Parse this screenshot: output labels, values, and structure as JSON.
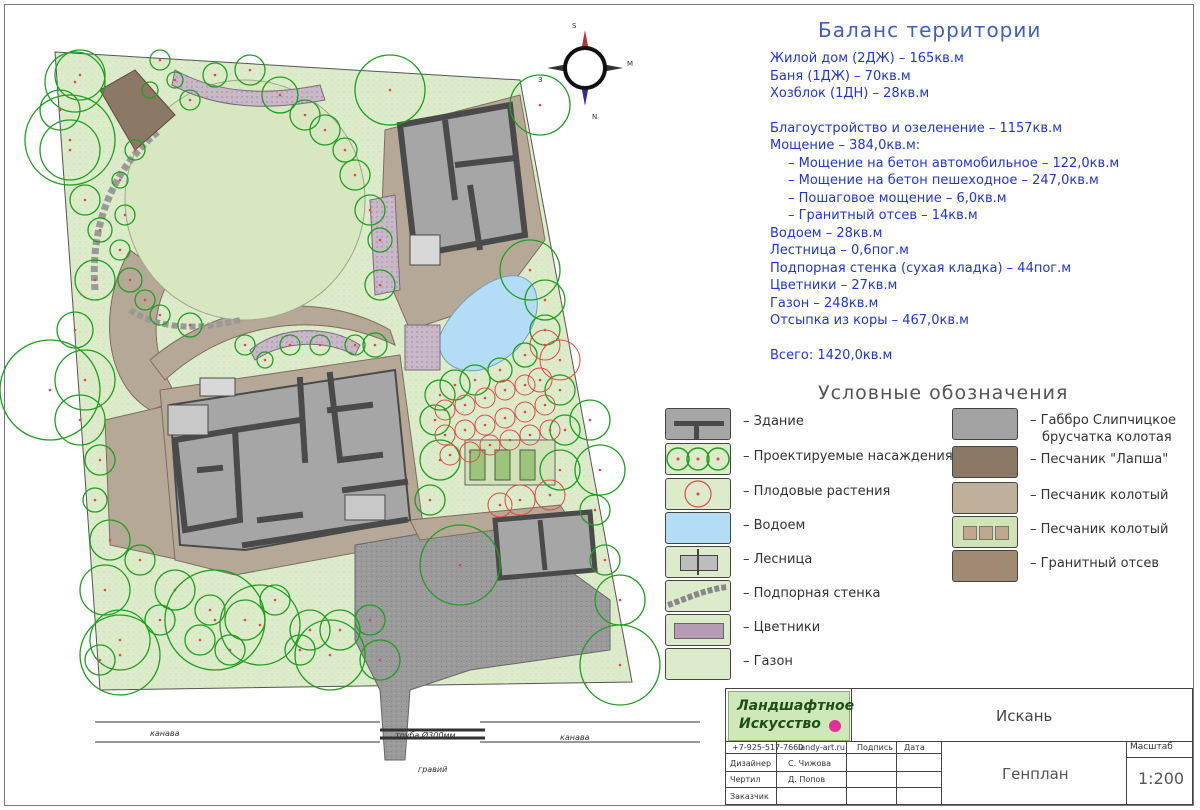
{
  "balance": {
    "title": "Баланс территории",
    "lines": [
      "Жилой дом (2ДЖ) – 165кв.м",
      "Баня (1ДЖ) – 70кв.м",
      "Хозблок (1ДН) – 28кв.м"
    ],
    "lines2": [
      "Благоустройство и озеленение – 1157кв.м",
      "Мощение – 384,0кв.м:"
    ],
    "sub": [
      "– Мощение на бетон автомобильное – 122,0кв.м",
      "– Мощение на бетон пешеходное – 247,0кв.м",
      "– Пошаговое мощение – 6,0кв.м",
      "– Гранитный отсев – 14кв.м"
    ],
    "lines3": [
      "Водоем – 28кв.м",
      "Лестница – 0,6пог.м",
      "Подпорная стенка (сухая кладка) – 44пог.м",
      "Цветники – 27кв.м",
      "Газон – 248кв.м",
      "Отсыпка из коры – 467,0кв.м"
    ],
    "total": "Всего: 1420,0кв.м"
  },
  "legend": {
    "title": "Условные обозначения",
    "left": [
      {
        "label": "– Здание",
        "icon": "building-swatch"
      },
      {
        "label": "– Проектируемые насаждения",
        "icon": "planting-swatch"
      },
      {
        "label": "– Плодовые растения",
        "icon": "fruit-swatch"
      },
      {
        "label": "– Водоем",
        "icon": "pond-swatch"
      },
      {
        "label": "– Лесница",
        "icon": "stairs-swatch"
      },
      {
        "label": "– Подпорная стенка",
        "icon": "retaining-wall-swatch"
      },
      {
        "label": "– Цветники",
        "icon": "flowerbed-swatch"
      },
      {
        "label": "– Газон",
        "icon": "lawn-swatch"
      }
    ],
    "right": [
      {
        "label": "– Габбро Слипчицкое",
        "label2": "брусчатка колотая",
        "color": "#a3a3a3"
      },
      {
        "label": "– Песчаник \"Лапша\"",
        "color": "#8b7965"
      },
      {
        "label": "– Песчаник колотый",
        "color": "#bfb09c"
      },
      {
        "label": "– Песчаник колотый",
        "color": "#cfe3b6"
      },
      {
        "label": "– Гранитный отсев",
        "color": "#a08a74"
      }
    ]
  },
  "compass": {
    "s": "S",
    "n": "N",
    "w": "З",
    "e": "M"
  },
  "plan_labels": {
    "ditch_left": "канава",
    "ditch_right": "канава",
    "pipe": "труба Ø300мм",
    "gravel": "гравий"
  },
  "title_block": {
    "logo_line1": "Ландшафтное",
    "logo_line2": "Искусство",
    "project": "Искань",
    "phone": "+7-925-517-7660",
    "site": "landy-art.ru",
    "col_sign": "Подпись",
    "col_date": "Дата",
    "role1": "Дизайнер",
    "name1": "С. Чижова",
    "role2": "Чертил",
    "name2": "Д. Попов",
    "role3": "Заказчик",
    "sheet": "Генплан",
    "scale_label": "Масштаб",
    "scale": "1:200"
  },
  "colors": {
    "lawn": "#dcebc9",
    "paving": "#b6a896",
    "building": "#a6a6a6",
    "wall": "#4a4a4a",
    "planting": "#1ea01e",
    "fruit": "#e04848",
    "water": "#b3dcf7",
    "text_blue": "#1f36d8"
  }
}
